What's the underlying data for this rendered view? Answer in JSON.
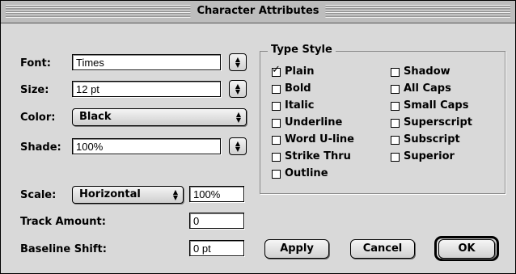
{
  "window": {
    "title": "Character Attributes"
  },
  "font": {
    "label": "Font:",
    "value": "Times"
  },
  "size": {
    "label": "Size:",
    "value": "12 pt"
  },
  "color": {
    "label": "Color:",
    "value": "Black"
  },
  "shade": {
    "label": "Shade:",
    "value": "100%"
  },
  "scale": {
    "label": "Scale:",
    "mode": "Horizontal",
    "value": "100%"
  },
  "track": {
    "label": "Track Amount:",
    "value": "0"
  },
  "baseline": {
    "label": "Baseline Shift:",
    "value": "0 pt"
  },
  "type_style": {
    "label": "Type Style",
    "left": [
      {
        "label": "Plain",
        "checked": true
      },
      {
        "label": "Bold",
        "checked": false
      },
      {
        "label": "Italic",
        "checked": false
      },
      {
        "label": "Underline",
        "checked": false
      },
      {
        "label": "Word U-line",
        "checked": false
      },
      {
        "label": "Strike Thru",
        "checked": false
      },
      {
        "label": "Outline",
        "checked": false
      }
    ],
    "right": [
      {
        "label": "Shadow",
        "checked": false
      },
      {
        "label": "All Caps",
        "checked": false
      },
      {
        "label": "Small Caps",
        "checked": false
      },
      {
        "label": "Superscript",
        "checked": false
      },
      {
        "label": "Subscript",
        "checked": false
      },
      {
        "label": "Superior",
        "checked": false
      }
    ]
  },
  "buttons": {
    "apply": "Apply",
    "cancel": "Cancel",
    "ok": "OK"
  },
  "icons": {
    "checkmark": "checkmark-icon",
    "stepper": "up-down-arrows-icon"
  }
}
